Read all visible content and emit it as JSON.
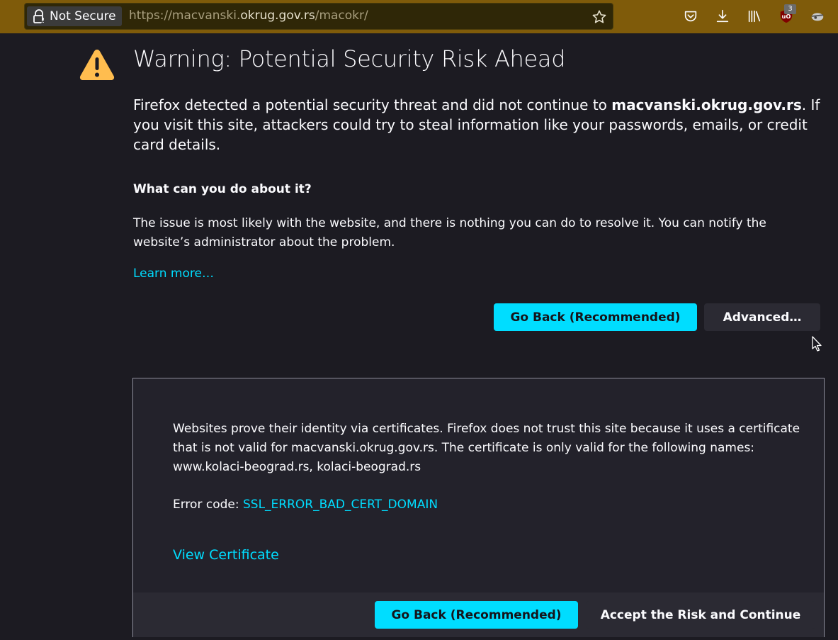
{
  "toolbar": {
    "not_secure_label": "Not Secure",
    "url_prefix": "https://macvanski.",
    "url_host": "okrug.gov.rs",
    "url_path": "/macokr/",
    "extension_badge": "3"
  },
  "page": {
    "title": "Warning: Potential Security Risk Ahead",
    "intro_before": "Firefox detected a potential security threat and did not continue to ",
    "intro_host": "macvanski.okrug.gov.rs",
    "intro_after": ". If you visit this site, attackers could try to steal information like your passwords, emails, or credit card details.",
    "subheading": "What can you do about it?",
    "description": "The issue is most likely with the website, and there is nothing you can do to resolve it. You can notify the website’s administrator about the problem.",
    "learn_more": "Learn more…",
    "go_back_label": "Go Back (Recommended)",
    "advanced_label": "Advanced…"
  },
  "advanced": {
    "explanation": "Websites prove their identity via certificates. Firefox does not trust this site because it uses a certificate that is not valid for macvanski.okrug.gov.rs. The certificate is only valid for the following names: www.kolaci-beograd.rs, kolaci-beograd.rs",
    "error_code_label": "Error code: ",
    "error_code": "SSL_ERROR_BAD_CERT_DOMAIN",
    "view_certificate": "View Certificate",
    "go_back_label": "Go Back (Recommended)",
    "accept_label": "Accept the Risk and Continue"
  },
  "colors": {
    "toolbar": "#7f5b0a",
    "background": "#1c1b22",
    "accent": "#00ddff",
    "warning": "#ffbd4f"
  }
}
